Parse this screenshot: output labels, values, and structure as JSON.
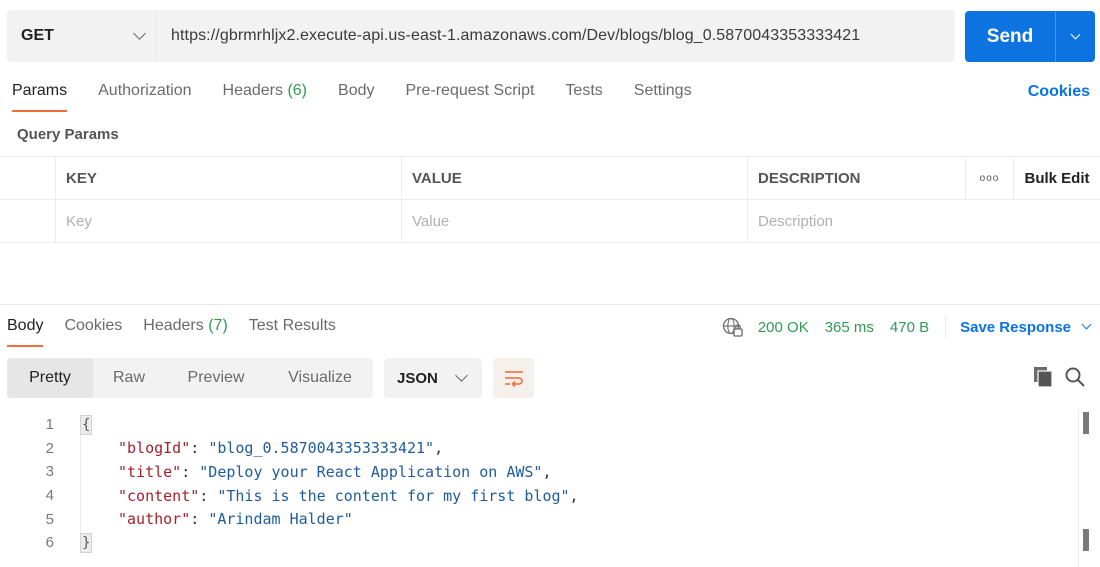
{
  "request": {
    "method": "GET",
    "url": "https://gbrmrhljx2.execute-api.us-east-1.amazonaws.com/Dev/blogs/blog_0.5870043353333421",
    "send_label": "Send"
  },
  "request_tabs": [
    {
      "label": "Params",
      "active": true
    },
    {
      "label": "Authorization"
    },
    {
      "label": "Headers",
      "badge": "(6)"
    },
    {
      "label": "Body"
    },
    {
      "label": "Pre-request Script"
    },
    {
      "label": "Tests"
    },
    {
      "label": "Settings"
    }
  ],
  "cookies_link": "Cookies",
  "query_params": {
    "title": "Query Params",
    "headers": {
      "key": "KEY",
      "value": "VALUE",
      "description": "DESCRIPTION",
      "more": "ooo",
      "bulk_edit": "Bulk Edit"
    },
    "placeholders": {
      "key": "Key",
      "value": "Value",
      "description": "Description"
    }
  },
  "response_tabs": [
    {
      "label": "Body",
      "active": true
    },
    {
      "label": "Cookies"
    },
    {
      "label": "Headers",
      "badge": "(7)"
    },
    {
      "label": "Test Results"
    }
  ],
  "response_status": {
    "status": "200 OK",
    "time": "365 ms",
    "size": "470 B",
    "save_label": "Save Response"
  },
  "format_tabs": [
    {
      "label": "Pretty",
      "active": true
    },
    {
      "label": "Raw"
    },
    {
      "label": "Preview"
    },
    {
      "label": "Visualize"
    }
  ],
  "format_select": "JSON",
  "body_lines": {
    "numbers": [
      "1",
      "2",
      "3",
      "4",
      "5",
      "6"
    ],
    "open": "{",
    "close": "}",
    "fields": [
      {
        "key": "\"blogId\"",
        "value": "\"blog_0.5870043353333421\"",
        "comma": ","
      },
      {
        "key": "\"title\"",
        "value": "\"Deploy your React Application on AWS\"",
        "comma": ","
      },
      {
        "key": "\"content\"",
        "value": "\"This is the content for my first blog\"",
        "comma": ","
      },
      {
        "key": "\"author\"",
        "value": "\"Arindam Halder\"",
        "comma": ""
      }
    ],
    "colon": ": "
  },
  "colors": {
    "accent": "#0c73e0",
    "active_tab_underline": "#f26b3a",
    "success": "#2e9b55",
    "json_key": "#a5212a",
    "json_string": "#1f5b9c"
  }
}
